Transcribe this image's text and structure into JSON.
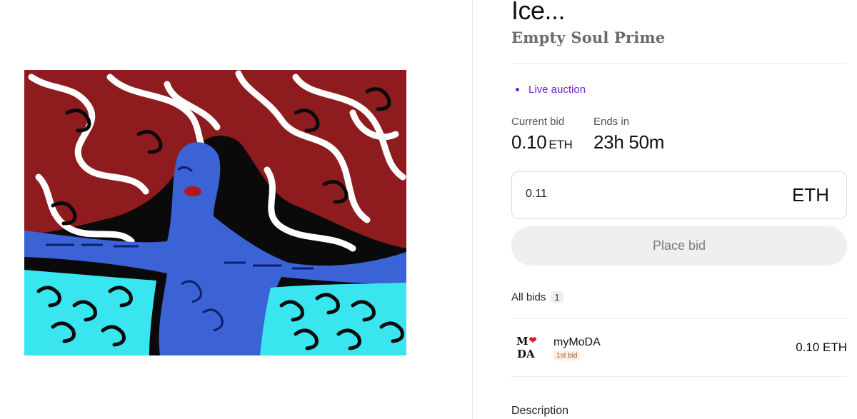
{
  "artwork": {
    "alt": "Ice... artwork"
  },
  "item": {
    "title": "Ice...",
    "artist": "Empty Soul Prime"
  },
  "auction": {
    "status": "Live auction",
    "current_bid_label": "Current bid",
    "current_bid_value": "0.10",
    "current_bid_unit": "ETH",
    "ends_in_label": "Ends in",
    "ends_in_value": "23h 50m"
  },
  "bid_form": {
    "amount": "0.11",
    "currency": "ETH",
    "place_bid_label": "Place bid"
  },
  "bids": {
    "heading": "All bids",
    "count": "1",
    "rows": [
      {
        "avatar_top": "M",
        "avatar_bottom": "DA",
        "bidder": "myMoDA",
        "tag": "1st bid",
        "amount": "0.10 ETH"
      }
    ]
  },
  "description": {
    "heading": "Description"
  },
  "colors": {
    "accent_purple": "#7a1fd6",
    "artwork_red": "#8e1c1f",
    "artwork_cyan": "#39e6f0",
    "artwork_blue": "#3b63d6"
  }
}
